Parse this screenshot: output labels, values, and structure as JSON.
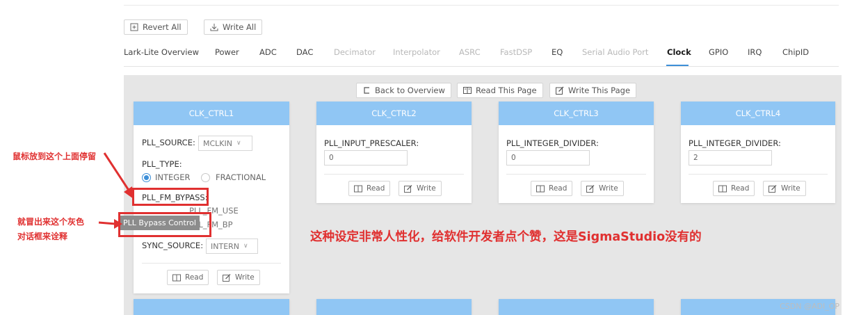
{
  "toolbar": {
    "revert_label": "Revert All",
    "write_label": "Write All"
  },
  "tabs": [
    {
      "label": "Lark-Lite Overview",
      "state": "normal"
    },
    {
      "label": "Power",
      "state": "normal"
    },
    {
      "label": "ADC",
      "state": "normal"
    },
    {
      "label": "DAC",
      "state": "normal"
    },
    {
      "label": "Decimator",
      "state": "disabled"
    },
    {
      "label": "Interpolator",
      "state": "disabled"
    },
    {
      "label": "ASRC",
      "state": "disabled"
    },
    {
      "label": "FastDSP",
      "state": "disabled"
    },
    {
      "label": "EQ",
      "state": "normal"
    },
    {
      "label": "Serial Audio Port",
      "state": "disabled"
    },
    {
      "label": "Clock",
      "state": "active"
    },
    {
      "label": "GPIO",
      "state": "normal"
    },
    {
      "label": "IRQ",
      "state": "normal"
    },
    {
      "label": "ChipID",
      "state": "normal"
    }
  ],
  "page_actions": {
    "back": "Back to Overview",
    "read": "Read This Page",
    "write": "Write This Page"
  },
  "cards": {
    "c1": {
      "title": "CLK_CTRL1",
      "pll_source_label": "PLL_SOURCE:",
      "pll_source_value": "MCLKIN",
      "pll_type_label": "PLL_TYPE:",
      "opt_integer": "INTEGER",
      "opt_fractional": "FRACTIONAL",
      "pll_fm_bypass_label": "PLL_FM_BYPASS:",
      "pll_fm_use": "PLL_FM_USE",
      "pll_fm_bp": "PLL_FM_BP",
      "sync_source_label": "SYNC_SOURCE:",
      "sync_source_value": "INTERN",
      "read": "Read",
      "write": "Write"
    },
    "c2": {
      "title": "CLK_CTRL2",
      "field_label": "PLL_INPUT_PRESCALER:",
      "field_value": "0",
      "read": "Read",
      "write": "Write"
    },
    "c3": {
      "title": "CLK_CTRL3",
      "field_label": "PLL_INTEGER_DIVIDER:",
      "field_value": "0",
      "read": "Read",
      "write": "Write"
    },
    "c4": {
      "title": "CLK_CTRL4",
      "field_label": "PLL_INTEGER_DIVIDER:",
      "field_value": "2",
      "read": "Read",
      "write": "Write"
    }
  },
  "tooltip": "PLL Bypass Control",
  "annotations": {
    "hover_note": "鼠标放到这个上面停留",
    "popup_note_line1": "就冒出来这个灰色",
    "popup_note_line2": "对话框来诠释",
    "praise": "这种设定非常人性化，给软件开发者点个赞，这是SigmaStudio没有的"
  },
  "watermark": "CSDN @ADI_OP",
  "colors": {
    "card_header": "#90c6f4",
    "accent": "#3d8fd8",
    "annotation": "#e03030",
    "panel_bg": "#e6e6e6"
  }
}
